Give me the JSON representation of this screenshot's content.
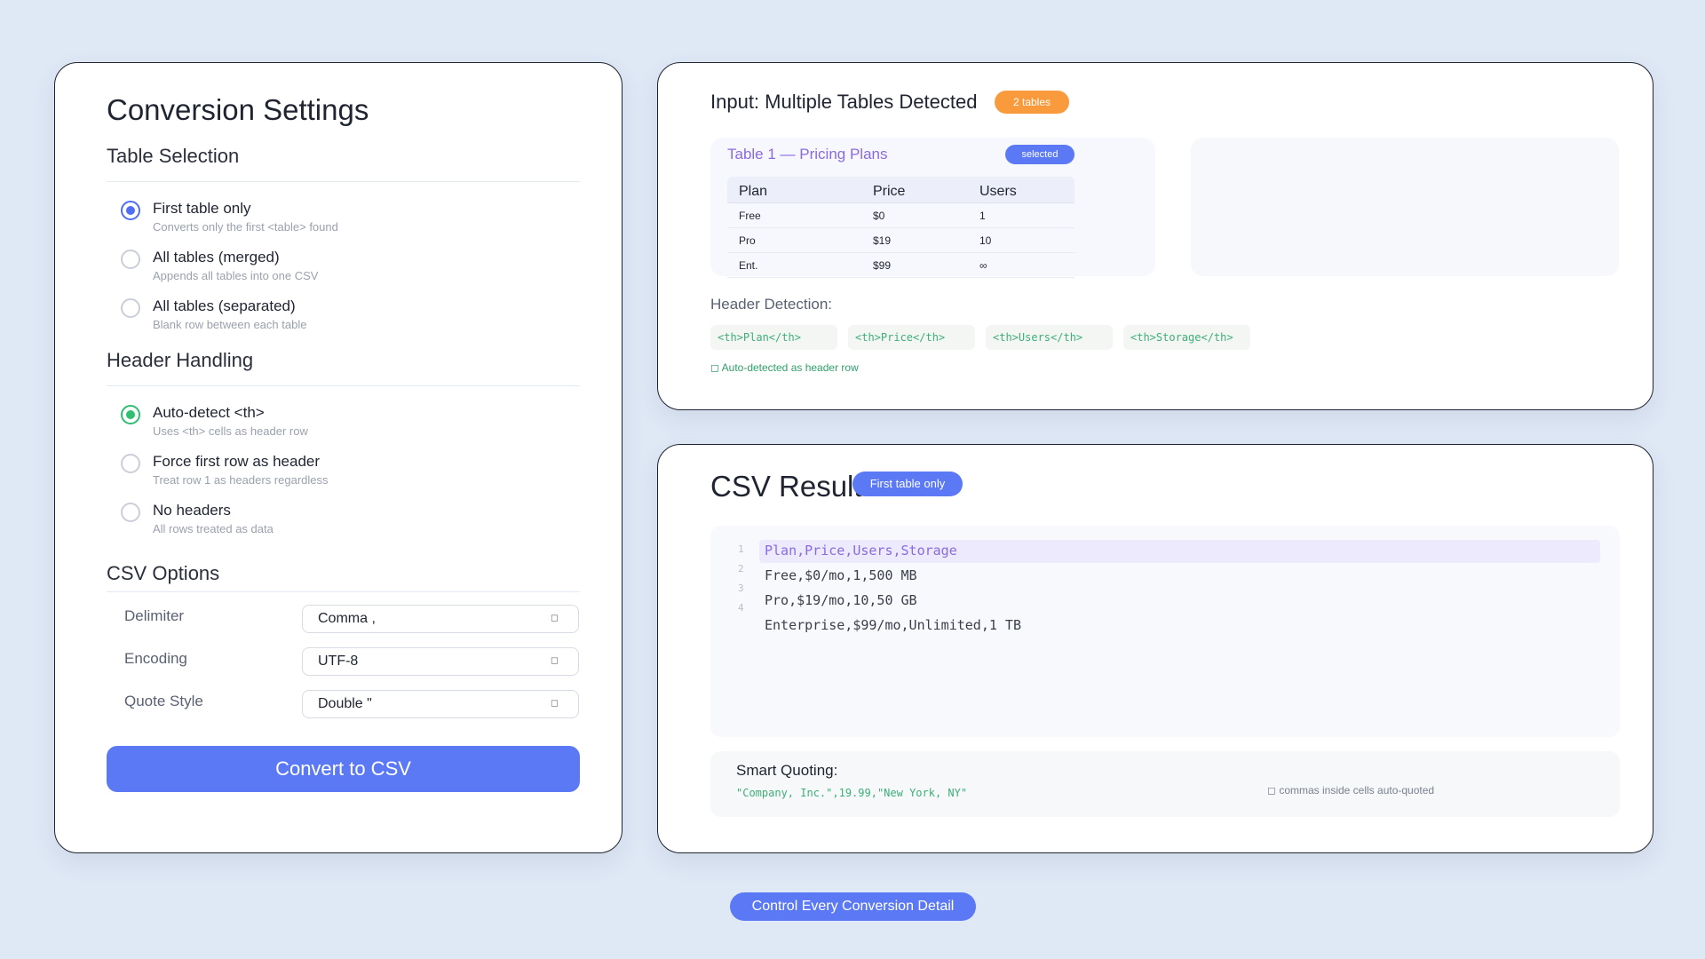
{
  "settings": {
    "title": "Conversion Settings",
    "table_selection": {
      "title": "Table Selection",
      "options": [
        {
          "label": "First table only",
          "desc": "Converts only the first <table> found"
        },
        {
          "label": "All tables (merged)",
          "desc": "Appends all tables into one CSV"
        },
        {
          "label": "All tables (separated)",
          "desc": "Blank row between each table"
        }
      ]
    },
    "header_handling": {
      "title": "Header Handling",
      "options": [
        {
          "label": "Auto-detect <th>",
          "desc": "Uses <th> cells as header row"
        },
        {
          "label": "Force first row as header",
          "desc": "Treat row 1 as headers regardless"
        },
        {
          "label": "No headers",
          "desc": "All rows treated as data"
        }
      ]
    },
    "csv_options": {
      "title": "CSV Options",
      "fields": [
        {
          "label": "Delimiter",
          "value": "Comma ,"
        },
        {
          "label": "Encoding",
          "value": "UTF-8"
        },
        {
          "label": "Quote Style",
          "value": "Double \""
        }
      ]
    },
    "convert_label": "Convert to CSV"
  },
  "input": {
    "title": "Input: Multiple Tables Detected",
    "badge": "2 tables",
    "table1": {
      "title": "Table 1 — Pricing Plans",
      "badge": "selected",
      "headers": [
        "Plan",
        "Price",
        "Users"
      ],
      "rows": [
        [
          "Free",
          "$0",
          "1"
        ],
        [
          "Pro",
          "$19",
          "10"
        ],
        [
          "Ent.",
          "$99",
          "∞"
        ]
      ]
    },
    "header_detection": {
      "label": "Header Detection:",
      "tags": [
        "<th>Plan</th>",
        "<th>Price</th>",
        "<th>Users</th>",
        "<th>Storage</th>"
      ],
      "note": "Auto-detected as header row"
    }
  },
  "result": {
    "title": "CSV Result",
    "badge": "First table only",
    "lines": [
      {
        "n": "1",
        "text": "Plan,Price,Users,Storage"
      },
      {
        "n": "2",
        "text": "Free,$0/mo,1,500 MB"
      },
      {
        "n": "3",
        "text": "Pro,$19/mo,10,50 GB"
      },
      {
        "n": "4",
        "text": "Enterprise,$99/mo,Unlimited,1 TB"
      }
    ],
    "smart_quoting": {
      "title": "Smart Quoting:",
      "example": "\"Company, Inc.\",19.99,\"New York, NY\"",
      "note": "commas inside cells auto-quoted"
    }
  },
  "footer": {
    "label": "Control Every Conversion Detail"
  },
  "colors": {
    "accent": "#5b79f5",
    "green": "#2fbf71",
    "orange": "#f99b3d",
    "purple": "#8a6bdf"
  },
  "icons": {
    "chevron": "chevron-down-icon",
    "check": "check-icon"
  }
}
